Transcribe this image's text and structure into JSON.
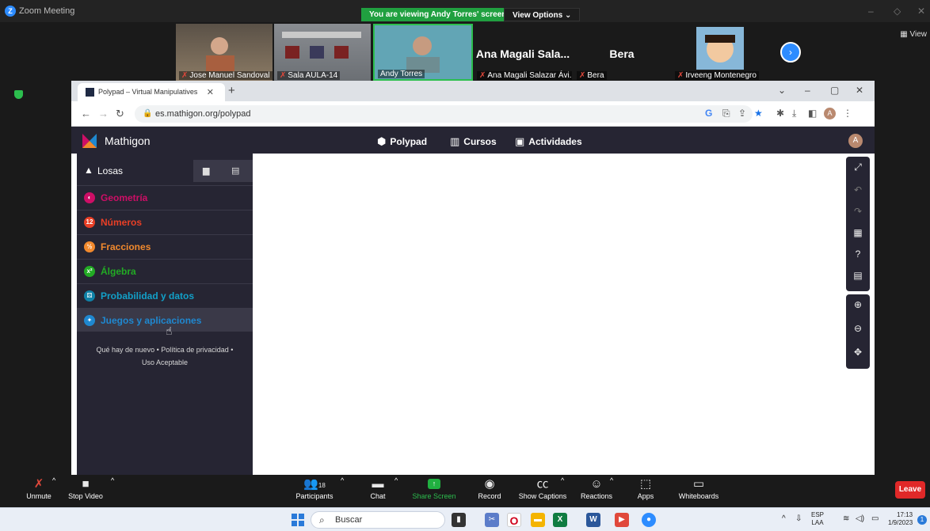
{
  "zoom": {
    "window_title": "Zoom Meeting",
    "viewing_banner": "You are viewing Andy Torres' screen",
    "view_options": "View Options",
    "view_label": "View",
    "participants": [
      {
        "name": "Jose Manuel Sandoval",
        "video": true
      },
      {
        "name": "Sala AULA-14",
        "video": true
      },
      {
        "name": "Andy Torres",
        "video": true
      },
      {
        "name": "Ana Magali Salazar Ávi...",
        "display": "Ana Magali Sala...",
        "video": false
      },
      {
        "name": "Bera",
        "display": "Bera",
        "video": false
      },
      {
        "name": "Irveeng Montenegro",
        "video": true
      }
    ],
    "controls": {
      "unmute": "Unmute",
      "stop_video": "Stop Video",
      "participants": "Participants",
      "participants_count": "18",
      "chat": "Chat",
      "share_screen": "Share Screen",
      "record": "Record",
      "show_captions": "Show Captions",
      "reactions": "Reactions",
      "apps": "Apps",
      "whiteboards": "Whiteboards",
      "leave": "Leave"
    }
  },
  "browser": {
    "tab_title": "Polypad – Virtual Manipulatives",
    "url": "es.mathigon.org/polypad"
  },
  "mathigon": {
    "brand": "Mathigon",
    "nav": [
      {
        "label": "Polypad",
        "icon": "shapes-icon"
      },
      {
        "label": "Cursos",
        "icon": "books-icon"
      },
      {
        "label": "Actividades",
        "icon": "gallery-icon"
      }
    ],
    "avatar_letter": "A",
    "panel": {
      "title": "Losas",
      "categories": [
        {
          "label": "Geometría",
          "color": "#cd0e66"
        },
        {
          "label": "Números",
          "color": "#e93f26"
        },
        {
          "label": "Fracciones",
          "color": "#f1892d"
        },
        {
          "label": "Álgebra",
          "color": "#22ab24"
        },
        {
          "label": "Probabilidad y datos",
          "color": "#0f82a8"
        },
        {
          "label": "Juegos y aplicaciones",
          "color": "#1f88d0"
        }
      ],
      "footer_line1": "Qué hay de nuevo • Política de privacidad •",
      "footer_line2": "Uso Aceptable"
    }
  },
  "taskbar": {
    "search_placeholder": "Buscar",
    "lang_line1": "ESP",
    "lang_line2": "LAA",
    "time": "17:13",
    "date": "1/9/2023",
    "notifications": "1"
  }
}
